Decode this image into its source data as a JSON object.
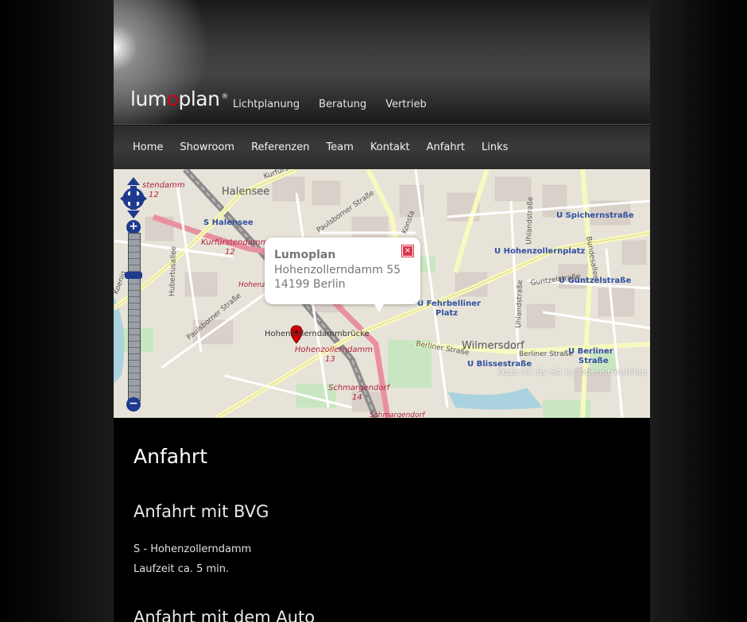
{
  "header": {
    "logo": {
      "pre": "lum",
      "o": "o",
      "post": "plan",
      "reg": "®"
    },
    "top_nav": [
      "Lichtplanung",
      "Beratung",
      "Vertrieb"
    ]
  },
  "main_nav": [
    "Home",
    "Showroom",
    "Referenzen",
    "Team",
    "Kontakt",
    "Anfahrt",
    "Links"
  ],
  "map": {
    "popup": {
      "title": "Lumoplan",
      "line1": "Hohenzollerndamm 55",
      "line2": "14199 Berlin",
      "close": "×"
    },
    "attribution": "Data CC-By-SA by OpenStreetMap",
    "zoom": {
      "plus": "+",
      "minus": "−"
    },
    "labels": {
      "halensee": "Halensee",
      "s_halensee": "S Halensee",
      "kurfuerstendamm": "Kurfürstendamm",
      "kurfuerstendamm_12": "12",
      "kurfuerstendamm_top": "stendamm",
      "kurfuerstendamm_top_12": "12",
      "kurfuerstenstr": "Kurfürstenstraße",
      "paulsborner1": "Paulsborner Straße",
      "paulsborner2": "Paulsborner Straße",
      "konstanzer": "Konsta",
      "uhlandstr1": "Uhlandstraße",
      "uhlandstr2": "Uhlandstraße",
      "bundesallee": "Bundesallee",
      "u_spichern": "U Spichernstraße",
      "u_hohenzollernplatz": "U Hohenzollernplatz",
      "u_guentzel": "U Güntzelstraße",
      "guntzelstr": "Guntzelstraße",
      "u_fehrbelliner": "U Fehrbelliner",
      "u_fehrbelliner2": "Platz",
      "hohenzollerndammbruecke": "Hohenzollerndammbrücke",
      "hohenzollerndamm_s": "Hohenzollerndamm",
      "hohenzollerndamm_13": "13",
      "hohenzollerndamm_mid": "Hohenz",
      "berliner_str": "Berliner Straße",
      "berliner_str2": "Berliner Straße",
      "wilmersdorf": "Wilmersdorf",
      "u_berliner": "U Berliner",
      "u_berliner2": "Straße",
      "u_blisse": "U Blissestraße",
      "schmargendorf": "Schmargendorf",
      "schmargendorf_14": "14",
      "schmargendorf2": "Schmargendorf",
      "huberts": "Hubertusallee",
      "koenig": "Koenig"
    }
  },
  "content": {
    "h1": "Anfahrt",
    "h2_bvg": "Anfahrt mit BVG",
    "bvg_line1": "S - Hohenzollerndamm",
    "bvg_line2": "Laufzeit ca. 5 min.",
    "h2_auto": "Anfahrt mit dem Auto"
  }
}
